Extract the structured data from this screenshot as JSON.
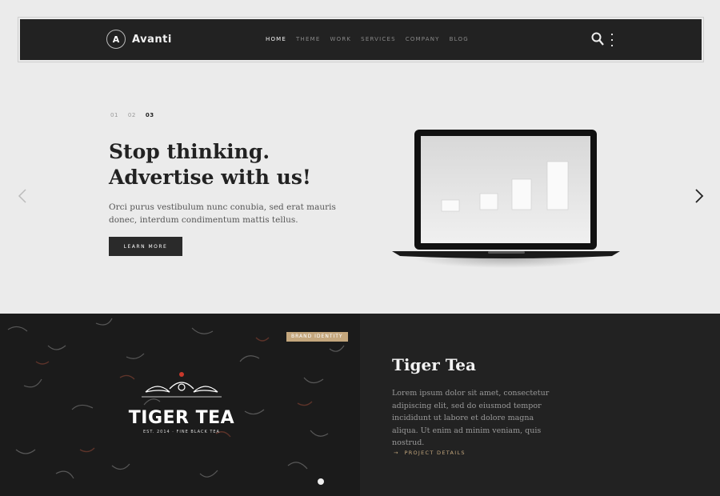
{
  "brand": {
    "name": "Avanti",
    "logo_glyph": "A"
  },
  "nav": {
    "items": [
      {
        "label": "HOME",
        "active": true
      },
      {
        "label": "THEME",
        "active": false
      },
      {
        "label": "WORK",
        "active": false
      },
      {
        "label": "SERVICES",
        "active": false
      },
      {
        "label": "COMPANY",
        "active": false
      },
      {
        "label": "BLOG",
        "active": false
      }
    ],
    "icons": [
      "search-icon",
      "more-vertical-icon"
    ]
  },
  "hero": {
    "slides": [
      "01",
      "02",
      "03"
    ],
    "active_slide": "03",
    "title": "Stop thinking. Advertise with us!",
    "text": "Orci purus vestibulum nunc conubia, sed erat mauris donec, interdum condimentum mattis tellus.",
    "button": "LEARN MORE",
    "icons": [
      "chevron-left-icon",
      "chevron-right-icon",
      "laptop-icon"
    ]
  },
  "project": {
    "badge": "BRAND IDENTITY",
    "brand_title": "TIGER TEA",
    "brand_sub": "EST. 2014 · FINE BLACK TEA",
    "title": "Tiger Tea",
    "text": "Lorem ipsum dolor sit amet, consectetur adipiscing elit, sed do eiusmod tempor incididunt ut labore et dolore magna aliqua. Ut enim ad minim veniam, quis nostrud.",
    "link": "PROJECT DETAILS",
    "link_arrow": "→"
  },
  "colors": {
    "accent": "#c4a77d",
    "dark": "#222222",
    "light": "#ebebeb"
  }
}
